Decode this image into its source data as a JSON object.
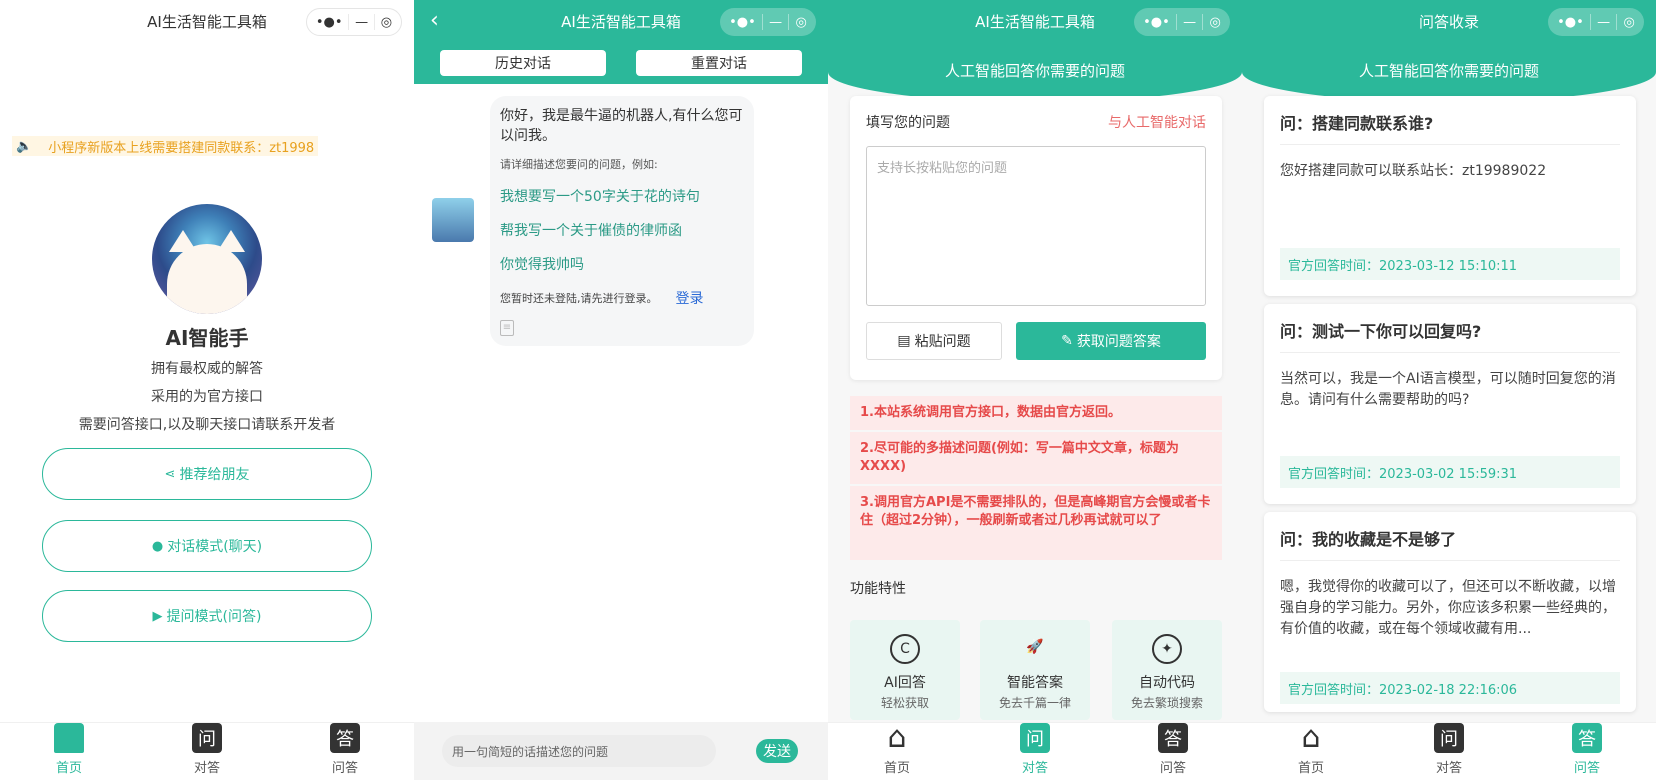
{
  "common": {
    "capsule_more": "•●•",
    "capsule_min": "—",
    "capsule_close": "◎"
  },
  "screen1": {
    "title": "AI生活智能工具箱",
    "marquee": "小程序新版本上线需要搭建同款联系：zt1998",
    "name": "AI智能手",
    "lines": [
      "拥有最权威的解答",
      "采用的为官方接口",
      "需要问答接口,以及聊天接口请联系开发者"
    ],
    "buttons": [
      "推荐给朋友",
      "对话模式(聊天)",
      "提问模式(问答)"
    ],
    "tabs": [
      "首页",
      "对答",
      "问答"
    ],
    "tab_icons": [
      "问",
      "答"
    ]
  },
  "screen2": {
    "title": "AI生活智能工具箱",
    "actions": [
      "历史对话",
      "重置对话"
    ],
    "greeting": "你好，我是最牛逼的机器人,有什么您可以问我。",
    "hint": "请详细描述您要问的问题，例如:",
    "examples": [
      "我想要写一个50字关于花的诗句",
      "帮我写一个关于催债的律师函",
      "你觉得我帅吗"
    ],
    "login_tip": "您暂时还未登陆,请先进行登录。",
    "login": "登录",
    "input_placeholder": "用一句简短的话描述您的问题",
    "send": "发送"
  },
  "screen3": {
    "title": "AI生活智能工具箱",
    "subtitle": "人工智能回答你需要的问题",
    "question_label": "填写您的问题",
    "human_link": "与人工智能对话",
    "textarea_placeholder": "支持长按粘贴您的问题",
    "paste": "粘贴问题",
    "get_answer": "获取问题答案",
    "notices": [
      "1.本站系统调用官方接口，数据由官方返回。",
      "2.尽可能的多描述问题(例如：写一篇中文文章，标题为XXXX)",
      "3.调用官方API是不需要排队的，但是高峰期官方会慢或者卡住（超过2分钟），一般刷新或者过几秒再试就可以了"
    ],
    "features_title": "功能特性",
    "features": [
      {
        "title": "AI回答",
        "sub": "轻松获取"
      },
      {
        "title": "智能答案",
        "sub": "免去千篇一律"
      },
      {
        "title": "自动代码",
        "sub": "免去繁琐搜索"
      }
    ],
    "tabs": [
      "首页",
      "对答",
      "问答"
    ]
  },
  "screen4": {
    "title": "问答收录",
    "subtitle": "人工智能回答你需要的问题",
    "items": [
      {
        "q": "问：搭建同款联系谁?",
        "a": "您好搭建同款可以联系站长：zt19989022",
        "time": "官方回答时间：2023-03-12 15:10:11"
      },
      {
        "q": "问：测试一下你可以回复吗?",
        "a": "当然可以，我是一个AI语言模型，可以随时回复您的消息。请问有什么需要帮助的吗?",
        "time": "官方回答时间：2023-03-02 15:59:31"
      },
      {
        "q": "问：我的收藏是不是够了",
        "a": "嗯，我觉得你的收藏可以了，但还可以不断收藏，以增强自身的学习能力。另外，你应该多积累一些经典的，有价值的收藏，或在每个领域收藏有用...",
        "time": "官方回答时间：2023-02-18 22:16:06"
      }
    ],
    "tabs": [
      "首页",
      "对答",
      "问答"
    ]
  },
  "colors": {
    "accent": "#2bb89a",
    "warning": "#e64a4a",
    "marquee": "#e8a11f"
  }
}
